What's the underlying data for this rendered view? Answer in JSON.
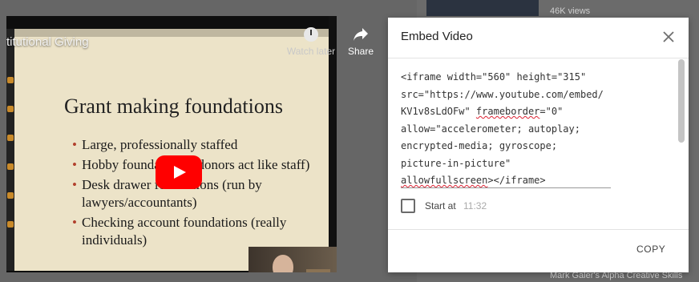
{
  "background": {
    "views_text": "46K views",
    "bottom_related_text": "Mark Galer's Alpha Creative Skills"
  },
  "video": {
    "title": "titutional Giving",
    "slide_heading": "Grant making foundations",
    "bullets": [
      "Large, professionally staffed",
      "Hobby founda           donors act like staff)",
      "Desk drawer  foundations (run by lawyers/accountants)",
      "Checking account foundations (really individuals)"
    ],
    "watch_later_label": "Watch later",
    "share_label": "Share",
    "play_button_color": "#ff0000"
  },
  "embed_dialog": {
    "title": "Embed Video",
    "code_lines": [
      "<iframe width=\"560\" height=\"315\"",
      "src=\"https://www.youtube.com/embed/",
      "KV1v8sLdOFw\" ",
      "allow=\"accelerometer; autoplay;",
      "encrypted-media; gyroscope;",
      "picture-in-picture\"",
      "></iframe>"
    ],
    "code_squiggle_1": "frameborder",
    "code_after_squiggle_1": "=\"0\"",
    "code_squiggle_2": "allowfullscreen",
    "start_at_label": "Start at",
    "start_at_time": "11:32",
    "copy_label": "COPY"
  }
}
